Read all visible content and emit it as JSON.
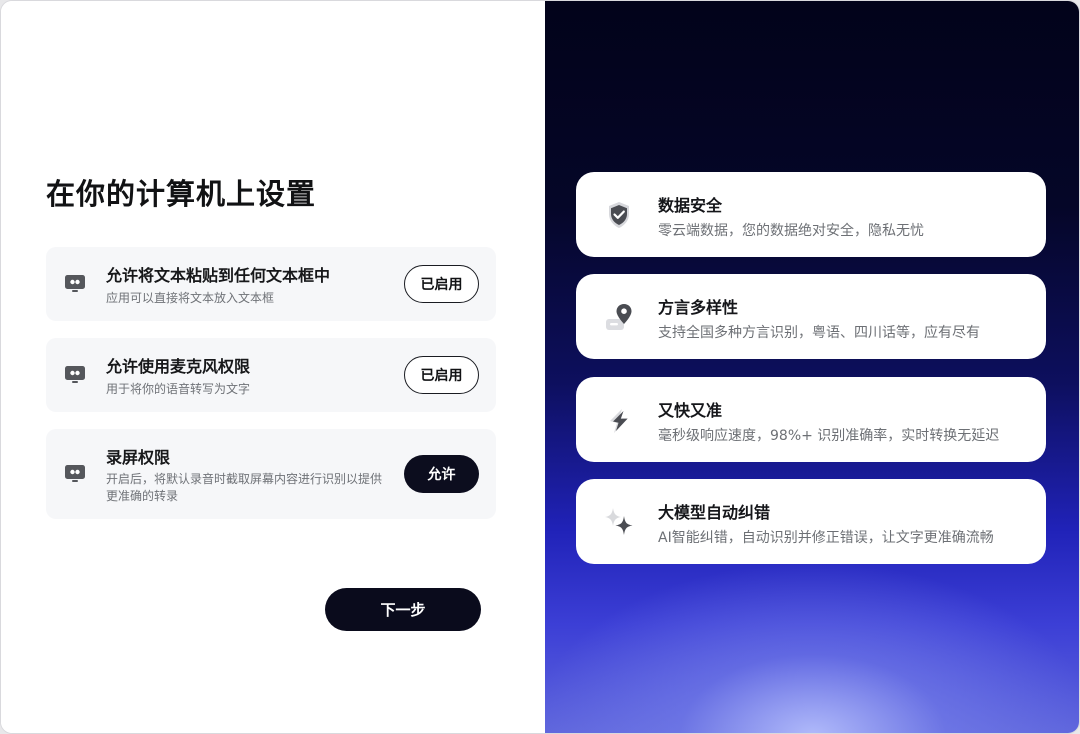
{
  "setup": {
    "title": "在你的计算机上设置",
    "permissions": [
      {
        "title": "允许将文本粘贴到任何文本框中",
        "description": "应用可以直接将文本放入文本框",
        "button": "已启用",
        "state": "enabled"
      },
      {
        "title": "允许使用麦克风权限",
        "description": "用于将你的语音转写为文字",
        "button": "已启用",
        "state": "enabled"
      },
      {
        "title": "录屏权限",
        "description": "开启后，将默认录音时截取屏幕内容进行识别以提供更准确的转录",
        "button": "允许",
        "state": "not-enabled"
      }
    ],
    "next_label": "下一步"
  },
  "features": [
    {
      "icon": "shield-check-icon",
      "title": "数据安全",
      "description": "零云端数据，您的数据绝对安全，隐私无忧"
    },
    {
      "icon": "map-pin-icon",
      "title": "方言多样性",
      "description": "支持全国多种方言识别，粤语、四川话等，应有尽有"
    },
    {
      "icon": "lightning-icon",
      "title": "又快又准",
      "description": "毫秒级响应速度，98%+ 识别准确率，实时转换无延迟"
    },
    {
      "icon": "sparkle-icon",
      "title": "大模型自动纠错",
      "description": "AI智能纠错，自动识别并修正错误，让文字更准确流畅"
    }
  ],
  "colors": {
    "primary_dark": "#0c0d1e",
    "panel_gradient_top": "#02031a",
    "panel_gradient_bottom": "#5f66dc",
    "card_bg": "#f6f7f9"
  }
}
